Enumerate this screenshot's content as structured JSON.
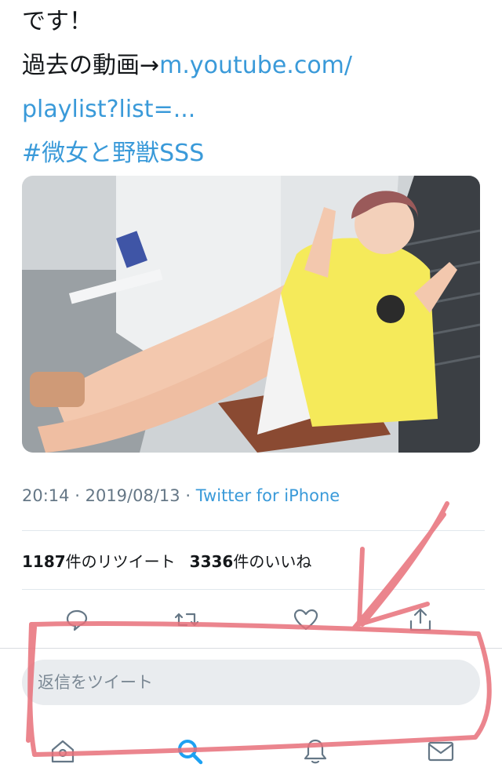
{
  "tweet": {
    "line1": "です！",
    "line2_prefix": "過去の動画→",
    "link_part1": "m.youtube.com/",
    "link_part2": "playlist?list=...",
    "hashtag": "#微女と野獣SSS",
    "time": "20:14",
    "date": "2019/08/13",
    "separator": "·",
    "source": "Twitter for iPhone"
  },
  "stats": {
    "retweet_count": "1187",
    "retweet_label": "件のリツイート",
    "like_count": "3336",
    "like_label": "件のいいね"
  },
  "actions": [
    "reply-icon",
    "retweet-icon",
    "heart-icon",
    "share-icon"
  ],
  "reply_box": {
    "placeholder": "返信をツイート"
  },
  "tabbar": {
    "items": [
      "home-icon",
      "search-icon",
      "notifications-icon",
      "messages-icon"
    ],
    "active": "search-icon"
  },
  "colors": {
    "link": "#3a9ad9",
    "muted": "#657786",
    "annotation": "#e8707a",
    "photo_shirt": "#f5ea5a"
  }
}
